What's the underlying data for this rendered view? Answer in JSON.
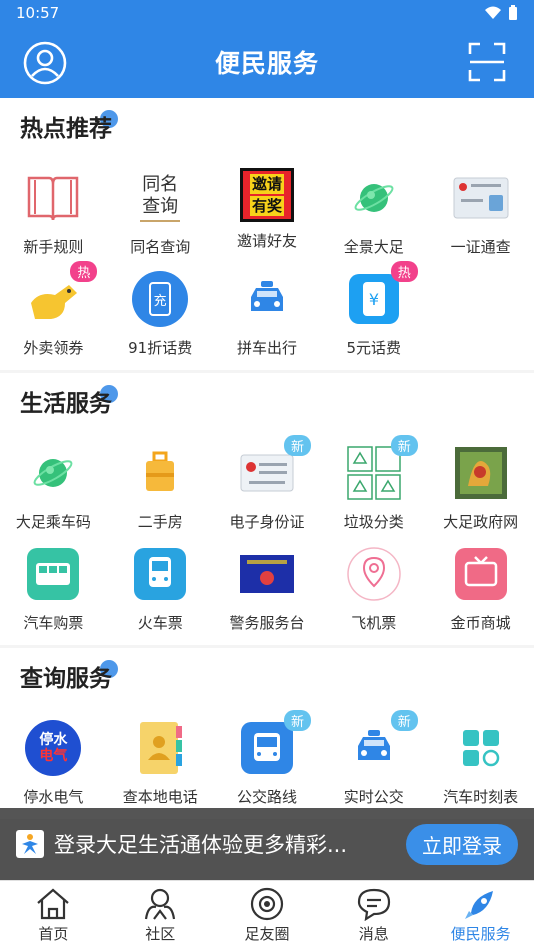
{
  "status_bar": {
    "time": "10:57"
  },
  "header": {
    "title": "便民服务"
  },
  "sections": [
    {
      "title": "热点推荐",
      "items": [
        {
          "label": "新手规则",
          "icon": "book-icon"
        },
        {
          "label": "同名查询",
          "icon": "same-name-query-icon",
          "icon_text": [
            "同名",
            "查询"
          ]
        },
        {
          "label": "邀请好友",
          "icon": "invite-reward-icon",
          "icon_text": [
            "邀请",
            "有奖"
          ]
        },
        {
          "label": "全景大足",
          "icon": "green-planet-icon"
        },
        {
          "label": "一证通查",
          "icon": "id-card-icon"
        },
        {
          "label": "外卖领券",
          "icon": "delivery-dog-icon",
          "badge": "热"
        },
        {
          "label": "91折话费",
          "icon": "phone-charge-icon",
          "icon_text": [
            "充"
          ]
        },
        {
          "label": "拼车出行",
          "icon": "taxi-icon"
        },
        {
          "label": "5元话费",
          "icon": "phone-yuan-icon",
          "badge": "热"
        }
      ]
    },
    {
      "title": "生活服务",
      "items": [
        {
          "label": "大足乘车码",
          "icon": "green-planet-icon"
        },
        {
          "label": "二手房",
          "icon": "luggage-icon"
        },
        {
          "label": "电子身份证",
          "icon": "e-id-card-icon",
          "badge": "新"
        },
        {
          "label": "垃圾分类",
          "icon": "recycle-icon",
          "badge": "新"
        },
        {
          "label": "大足政府网",
          "icon": "government-logo-icon"
        },
        {
          "label": "汽车购票",
          "icon": "bus-ticket-icon"
        },
        {
          "label": "火车票",
          "icon": "train-icon"
        },
        {
          "label": "警务服务台",
          "icon": "police-service-icon"
        },
        {
          "label": "飞机票",
          "icon": "location-pin-icon"
        },
        {
          "label": "金币商城",
          "icon": "tv-shop-icon"
        }
      ]
    },
    {
      "title": "查询服务",
      "items": [
        {
          "label": "停水电气",
          "icon": "water-electric-icon",
          "icon_text": [
            "停水",
            "电气"
          ]
        },
        {
          "label": "查本地电话",
          "icon": "phonebook-icon"
        },
        {
          "label": "公交路线",
          "icon": "bus-route-icon",
          "badge": "新"
        },
        {
          "label": "实时公交",
          "icon": "realtime-bus-icon",
          "badge": "新"
        },
        {
          "label": "汽车时刻表",
          "icon": "schedule-grid-icon"
        }
      ]
    }
  ],
  "login_banner": {
    "text": "登录大足生活通体验更多精彩...",
    "button": "立即登录"
  },
  "tabs": [
    {
      "label": "首页",
      "icon": "home-icon",
      "active": false
    },
    {
      "label": "社区",
      "icon": "community-icon",
      "active": false
    },
    {
      "label": "足友圈",
      "icon": "camera-circle-icon",
      "active": false
    },
    {
      "label": "消息",
      "icon": "message-icon",
      "active": false
    },
    {
      "label": "便民服务",
      "icon": "rocket-icon",
      "active": true
    }
  ],
  "colors": {
    "primary": "#2f86e6",
    "hot": "#f2418b",
    "new": "#63c3ef"
  }
}
